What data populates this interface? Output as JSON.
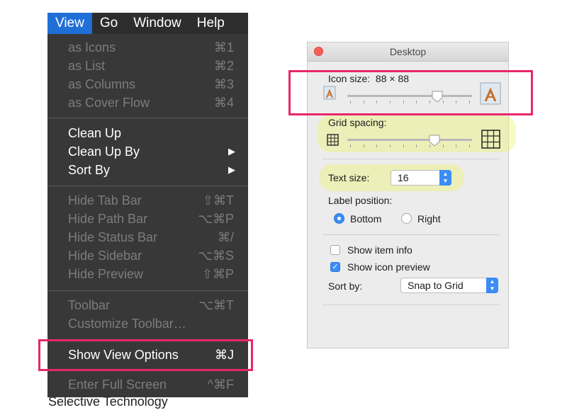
{
  "menubar": {
    "items": [
      {
        "label": "View",
        "active": true
      },
      {
        "label": "Go",
        "active": false
      },
      {
        "label": "Window",
        "active": false
      },
      {
        "label": "Help",
        "active": false
      }
    ]
  },
  "menu": {
    "as_icons": {
      "label": "as Icons",
      "shortcut": "⌘1"
    },
    "as_list": {
      "label": "as List",
      "shortcut": "⌘2"
    },
    "as_columns": {
      "label": "as Columns",
      "shortcut": "⌘3"
    },
    "as_cover_flow": {
      "label": "as Cover Flow",
      "shortcut": "⌘4"
    },
    "clean_up": {
      "label": "Clean Up"
    },
    "clean_up_by": {
      "label": "Clean Up By",
      "arrow": "▶"
    },
    "sort_by": {
      "label": "Sort By",
      "arrow": "▶"
    },
    "hide_tab_bar": {
      "label": "Hide Tab Bar",
      "shortcut": "⇧⌘T"
    },
    "hide_path_bar": {
      "label": "Hide Path Bar",
      "shortcut": "⌥⌘P"
    },
    "hide_status_bar": {
      "label": "Hide Status Bar",
      "shortcut": "⌘/"
    },
    "hide_sidebar": {
      "label": "Hide Sidebar",
      "shortcut": "⌥⌘S"
    },
    "hide_preview": {
      "label": "Hide Preview",
      "shortcut": "⇧⌘P"
    },
    "toolbar": {
      "label": "Toolbar",
      "shortcut": "⌥⌘T"
    },
    "customize_toolbar": {
      "label": "Customize Toolbar…"
    },
    "show_view_options": {
      "label": "Show View Options",
      "shortcut": "⌘J"
    },
    "enter_full_screen": {
      "label": "Enter Full Screen",
      "shortcut": "^⌘F"
    }
  },
  "background_text": "Selective Technology",
  "panel": {
    "title": "Desktop",
    "icon_size_label": "Icon size:",
    "icon_size_value": "88 × 88",
    "icon_size_fraction": 0.72,
    "grid_spacing_label": "Grid spacing:",
    "grid_spacing_fraction": 0.7,
    "text_size_label": "Text size:",
    "text_size_value": "16",
    "label_position_label": "Label position:",
    "bottom_label": "Bottom",
    "right_label": "Right",
    "show_item_info_label": "Show item info",
    "show_item_info_checked": false,
    "show_icon_preview_label": "Show icon preview",
    "show_icon_preview_checked": true,
    "sort_by_label": "Sort by:",
    "sort_by_value": "Snap to Grid"
  },
  "colors": {
    "menu_bg": "#383838",
    "menu_active": "#1f6fd6",
    "highlight_box": "#e8266b",
    "highlight_yellow": "#eef478",
    "accent": "#3b8cf5"
  }
}
